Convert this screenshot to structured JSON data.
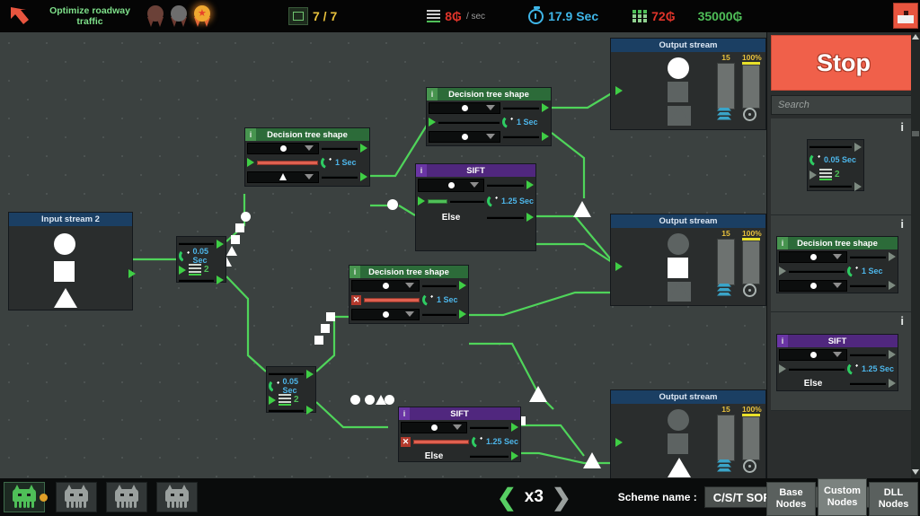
{
  "topbar": {
    "back_icon": "back-arrow-icon",
    "mission_title": "Optimize roadway traffic",
    "medals": [
      {
        "name": "bronze-medal",
        "state": "locked"
      },
      {
        "name": "silver-medal",
        "state": "locked"
      },
      {
        "name": "gold-medal",
        "state": "earned",
        "star": "★"
      }
    ],
    "tasks": {
      "icon": "task-icon",
      "value": "7 / 7"
    },
    "income": {
      "icon": "bars-icon",
      "value": "8₲",
      "suffix": "/ sec"
    },
    "timer": {
      "icon": "stopwatch-icon",
      "value": "17.9 Sec"
    },
    "cost": {
      "icon": "grid-icon",
      "value": "72₲"
    },
    "money": {
      "value": "35000₲"
    },
    "trash_button": "delete-icon"
  },
  "canvas": {
    "input_stream": {
      "title": "Input stream 2",
      "shapes": [
        "circle",
        "square",
        "triangle"
      ]
    },
    "output_streams": [
      {
        "title": "Output stream",
        "active_shape": "circle",
        "count": "15",
        "percent": "100%"
      },
      {
        "title": "Output stream",
        "active_shape": "square",
        "count": "15",
        "percent": "100%"
      },
      {
        "title": "Output stream",
        "active_shape": "triangle",
        "count": "15",
        "percent": "100%"
      }
    ],
    "nodes": [
      {
        "id": "delay_a",
        "type": "delay",
        "speed": "0.05 Sec",
        "count": "2"
      },
      {
        "id": "delay_b",
        "type": "delay",
        "speed": "0.05 Sec",
        "count": "2"
      },
      {
        "id": "dt_left",
        "type": "decision",
        "title": "Decision tree shape",
        "info": "i",
        "speed": "1 Sec",
        "top_shape": "circle",
        "bottom_shape": "triangle",
        "bar": "red",
        "error": false
      },
      {
        "id": "dt_top",
        "type": "decision",
        "title": "Decision tree shape",
        "info": "i",
        "speed": "1 Sec",
        "top_shape": "circle",
        "bottom_shape": "circle",
        "bar": "none",
        "error": false
      },
      {
        "id": "dt_mid",
        "type": "decision",
        "title": "Decision tree shape",
        "info": "i",
        "speed": "1 Sec",
        "top_shape": "circle",
        "bottom_shape": "circle",
        "bar": "red",
        "error": true
      },
      {
        "id": "sift_top",
        "type": "sift",
        "title": "SIFT",
        "info": "i",
        "speed": "1.25 Sec",
        "top_shape": "circle",
        "else_label": "Else",
        "bar": "green",
        "error": false
      },
      {
        "id": "sift_bottom",
        "type": "sift",
        "title": "SIFT",
        "info": "i",
        "speed": "1.25 Sec",
        "top_shape": "circle",
        "else_label": "Else",
        "bar": "red",
        "error": true
      }
    ]
  },
  "sidebar": {
    "stop_label": "Stop",
    "search_placeholder": "Search",
    "palette": [
      {
        "info": "i",
        "type": "delay",
        "speed": "0.05 Sec",
        "count": "2"
      },
      {
        "info": "i",
        "type": "decision",
        "title": "Decision tree shape",
        "node_info": "i",
        "speed": "1 Sec"
      },
      {
        "info": "i",
        "type": "sift",
        "title": "SIFT",
        "node_info": "i",
        "speed": "1.25 Sec",
        "else_label": "Else"
      }
    ]
  },
  "bottombar": {
    "bots": [
      {
        "name": "bot-slot-1",
        "active": true,
        "badge": "coin"
      },
      {
        "name": "bot-slot-2",
        "active": false
      },
      {
        "name": "bot-slot-3",
        "active": false
      },
      {
        "name": "bot-slot-4",
        "active": false
      }
    ],
    "speed": {
      "prev": "❮",
      "value": "x3",
      "next": "❯"
    },
    "scheme_label": "Scheme name :",
    "scheme_value": "C/S/T SORT",
    "tabs": [
      {
        "line1": "Base",
        "line2": "Nodes",
        "active": false
      },
      {
        "line1": "Custom",
        "line2": "Nodes",
        "active": true
      },
      {
        "line1": "DLL",
        "line2": "Nodes",
        "active": false
      }
    ]
  },
  "colors": {
    "accent_green": "#4fbf58",
    "accent_red": "#e0342a",
    "accent_blue": "#3fb6e8",
    "money_green": "#4fbf58",
    "stop_red": "#f0604a",
    "decision_header": "#2c6b39",
    "sift_header": "#50277e",
    "stream_header": "#1b3f63"
  }
}
